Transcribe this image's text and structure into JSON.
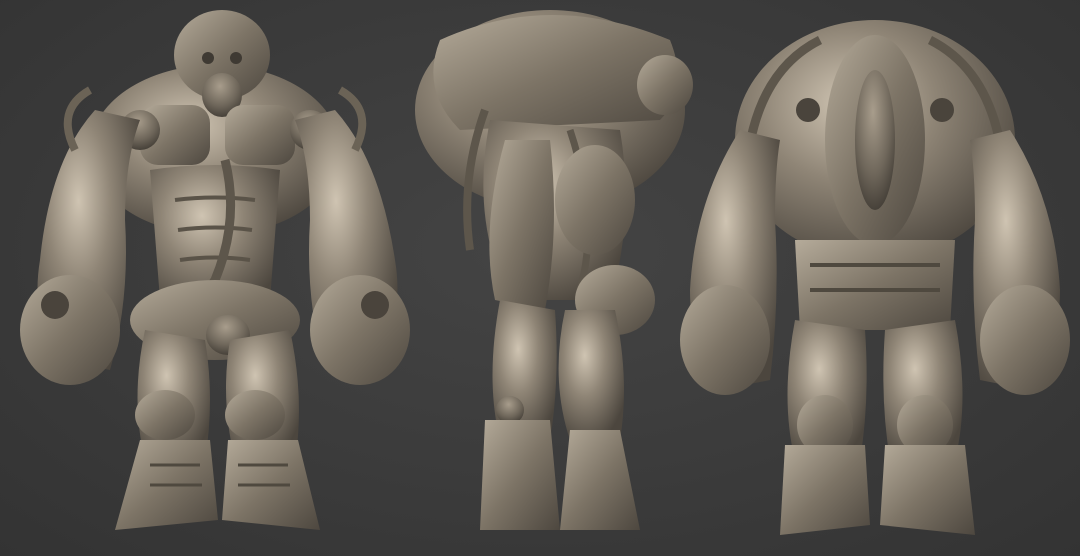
{
  "scene": {
    "background_color": "#3a3a3a",
    "material_color": "#8b8174",
    "highlight_color": "#c9bfae",
    "shadow_color": "#4a443c",
    "views": [
      {
        "id": "front",
        "icon": "creature-front-view"
      },
      {
        "id": "side",
        "icon": "creature-side-view"
      },
      {
        "id": "back",
        "icon": "creature-back-view"
      }
    ]
  }
}
